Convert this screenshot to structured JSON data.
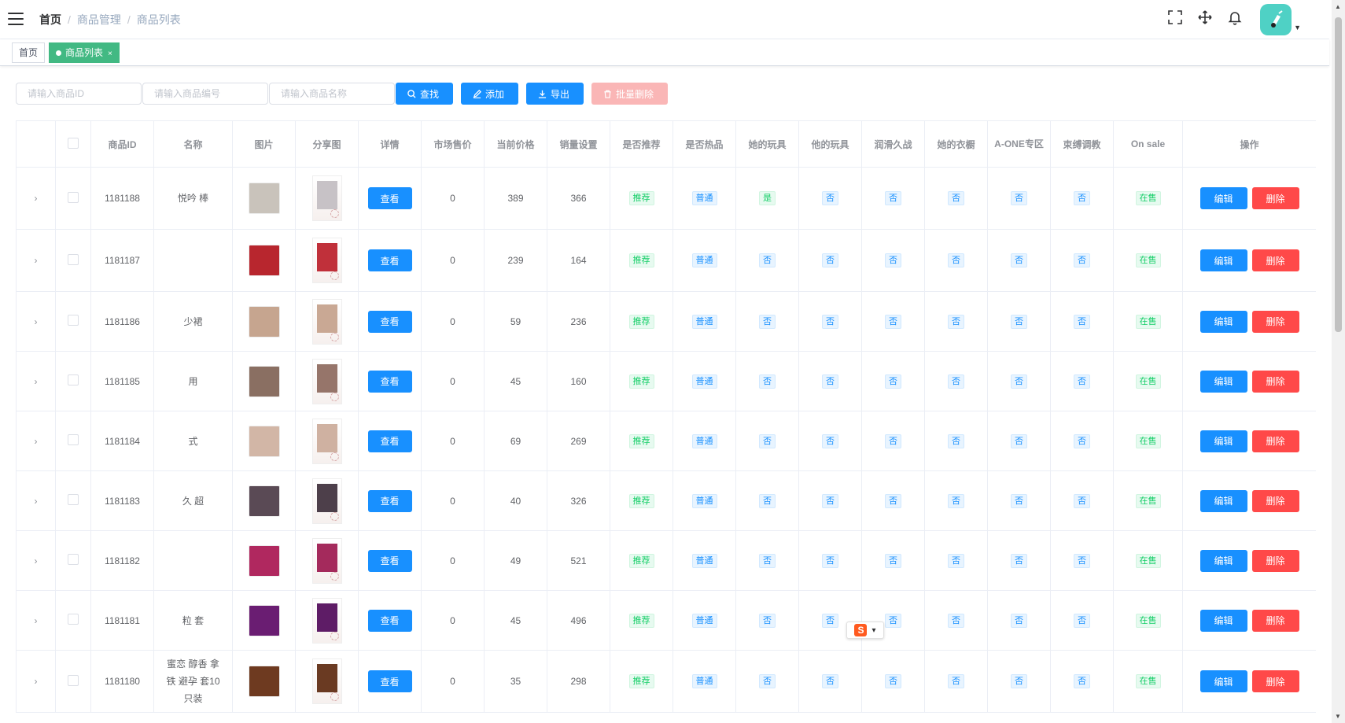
{
  "breadcrumb": {
    "home": "首页",
    "level1": "商品管理",
    "level2": "商品列表"
  },
  "header_icons": [
    "fullscreen-icon",
    "drag-move-icon",
    "bell-icon"
  ],
  "tags": {
    "home": "首页",
    "active": "商品列表",
    "close": "×"
  },
  "filters": {
    "id_placeholder": "请输入商品ID",
    "code_placeholder": "请输入商品编号",
    "name_placeholder": "请输入商品名称",
    "search_label": "查找",
    "add_label": "添加",
    "export_label": "导出",
    "batch_delete_label": "批量删除"
  },
  "table": {
    "headers": [
      "商品ID",
      "名称",
      "图片",
      "分享图",
      "详情",
      "市场售价",
      "当前价格",
      "销量设置",
      "是否推荐",
      "是否热品",
      "她的玩具",
      "他的玩具",
      "润滑久战",
      "她的衣橱",
      "A-ONE专区",
      "束缚调教",
      "On sale",
      "操作"
    ],
    "view_label": "查看",
    "edit_label": "编辑",
    "delete_label": "删除",
    "expand_icon": "›",
    "rows": [
      {
        "id": "1181188",
        "name": "悦吟 棒",
        "market": "0",
        "price": "389",
        "sales": "366",
        "recommend": "推荐",
        "hot": "普通",
        "her": "是",
        "his": "否",
        "lube": "否",
        "wardrobe": "否",
        "aone": "否",
        "bondage": "否",
        "onsale": "在售",
        "thumb": "#c9c3bb",
        "share": "#c7c2c6"
      },
      {
        "id": "1181187",
        "name": "",
        "market": "0",
        "price": "239",
        "sales": "164",
        "recommend": "推荐",
        "hot": "普通",
        "her": "否",
        "his": "否",
        "lube": "否",
        "wardrobe": "否",
        "aone": "否",
        "bondage": "否",
        "onsale": "在售",
        "thumb": "#b8262e",
        "share": "#c0303a"
      },
      {
        "id": "1181186",
        "name": "少裙",
        "market": "0",
        "price": "59",
        "sales": "236",
        "recommend": "推荐",
        "hot": "普通",
        "her": "否",
        "his": "否",
        "lube": "否",
        "wardrobe": "否",
        "aone": "否",
        "bondage": "否",
        "onsale": "在售",
        "thumb": "#c6a58f",
        "share": "#c9a894"
      },
      {
        "id": "1181185",
        "name": "用",
        "market": "0",
        "price": "45",
        "sales": "160",
        "recommend": "推荐",
        "hot": "普通",
        "her": "否",
        "his": "否",
        "lube": "否",
        "wardrobe": "否",
        "aone": "否",
        "bondage": "否",
        "onsale": "在售",
        "thumb": "#8a6f62",
        "share": "#96756a"
      },
      {
        "id": "1181184",
        "name": "式",
        "market": "0",
        "price": "69",
        "sales": "269",
        "recommend": "推荐",
        "hot": "普通",
        "her": "否",
        "his": "否",
        "lube": "否",
        "wardrobe": "否",
        "aone": "否",
        "bondage": "否",
        "onsale": "在售",
        "thumb": "#d2b6a6",
        "share": "#cfb1a1"
      },
      {
        "id": "1181183",
        "name": "久 超",
        "market": "0",
        "price": "40",
        "sales": "326",
        "recommend": "推荐",
        "hot": "普通",
        "her": "否",
        "his": "否",
        "lube": "否",
        "wardrobe": "否",
        "aone": "否",
        "bondage": "否",
        "onsale": "在售",
        "thumb": "#5a4a55",
        "share": "#4d3f4a"
      },
      {
        "id": "1181182",
        "name": "",
        "market": "0",
        "price": "49",
        "sales": "521",
        "recommend": "推荐",
        "hot": "普通",
        "her": "否",
        "his": "否",
        "lube": "否",
        "wardrobe": "否",
        "aone": "否",
        "bondage": "否",
        "onsale": "在售",
        "thumb": "#b0285f",
        "share": "#a42a5c"
      },
      {
        "id": "1181181",
        "name": "粒 套",
        "market": "0",
        "price": "45",
        "sales": "496",
        "recommend": "推荐",
        "hot": "普通",
        "her": "否",
        "his": "否",
        "lube": "否",
        "wardrobe": "否",
        "aone": "否",
        "bondage": "否",
        "onsale": "在售",
        "thumb": "#6a1d72",
        "share": "#5e1c66"
      },
      {
        "id": "1181180",
        "name": "蜜恋 醇香 拿铁 避孕 套10只装",
        "market": "0",
        "price": "35",
        "sales": "298",
        "recommend": "推荐",
        "hot": "普通",
        "her": "否",
        "his": "否",
        "lube": "否",
        "wardrobe": "否",
        "aone": "否",
        "bondage": "否",
        "onsale": "在售",
        "thumb": "#6e3a20",
        "share": "#6a3a22"
      }
    ]
  },
  "ime_widget": {
    "letter": "S"
  }
}
